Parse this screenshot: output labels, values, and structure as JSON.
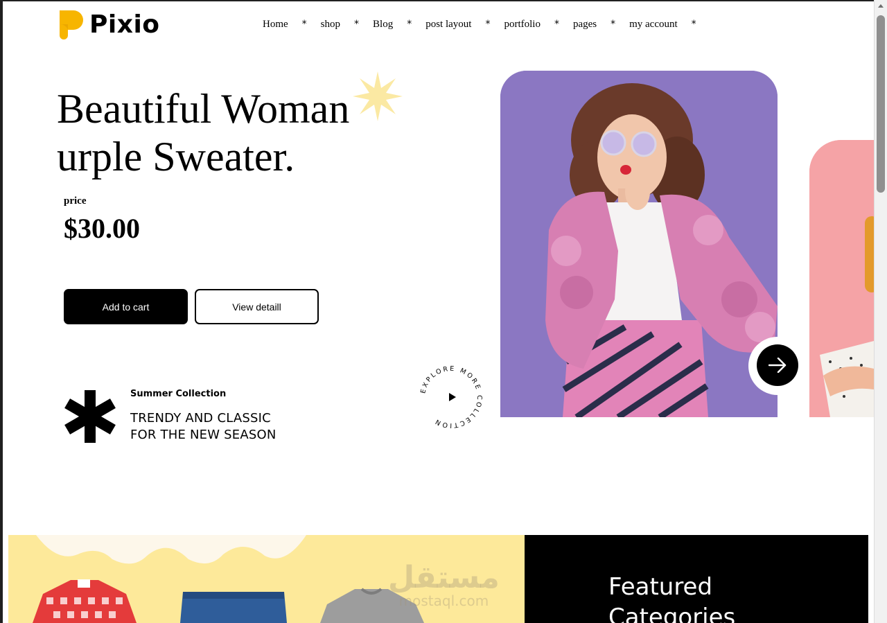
{
  "brand": {
    "name": "Pixio",
    "accent": "#f7b500"
  },
  "nav": {
    "items": [
      {
        "label": "Home"
      },
      {
        "label": "shop"
      },
      {
        "label": "Blog"
      },
      {
        "label": "post layout"
      },
      {
        "label": "portfolio"
      },
      {
        "label": "pages"
      },
      {
        "label": "my account"
      }
    ],
    "separator": "*"
  },
  "hero": {
    "title_line1": "Beautiful Woman",
    "title_line2": "urple Sweater.",
    "price_label": "price",
    "price_value": "$30.00",
    "add_to_cart": "Add to cart",
    "view_detail": "View detaill",
    "collection_label": "Summer Collection",
    "tagline_line1": "TRENDY AND CLASSIC",
    "tagline_line2": "FOR THE NEW SEASON",
    "explore_text": "EXPLORE MORE COLLECTION",
    "image_bg": "#8b77c2",
    "second_image_bg": "#f5a3a6"
  },
  "categories": {
    "heading_line1": "Featured",
    "heading_line2": "Categories",
    "band_color": "#fde99a"
  },
  "watermark": {
    "arabic": "مستقل",
    "latin": "mostaql.com"
  }
}
